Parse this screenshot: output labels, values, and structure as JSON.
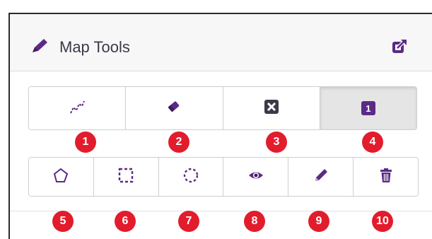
{
  "header": {
    "title": "Map Tools"
  },
  "toolbar_top": [
    {
      "icon": "polyline-icon",
      "badge": "1"
    },
    {
      "icon": "eraser-icon",
      "badge": "2"
    },
    {
      "icon": "close-box-icon",
      "badge": "3"
    },
    {
      "icon": "number-one-box-icon",
      "label": "1",
      "badge": "4",
      "active": true
    }
  ],
  "toolbar_bottom": [
    {
      "icon": "polygon-icon",
      "badge": "5"
    },
    {
      "icon": "rectangle-select-icon",
      "badge": "6"
    },
    {
      "icon": "circle-select-icon",
      "badge": "7"
    },
    {
      "icon": "eye-icon",
      "badge": "8"
    },
    {
      "icon": "pencil-icon",
      "badge": "9"
    },
    {
      "icon": "trash-icon",
      "badge": "10"
    }
  ],
  "colors": {
    "accent": "#5b2a86",
    "badge": "#e21c2c",
    "border": "#2b2b2b"
  }
}
